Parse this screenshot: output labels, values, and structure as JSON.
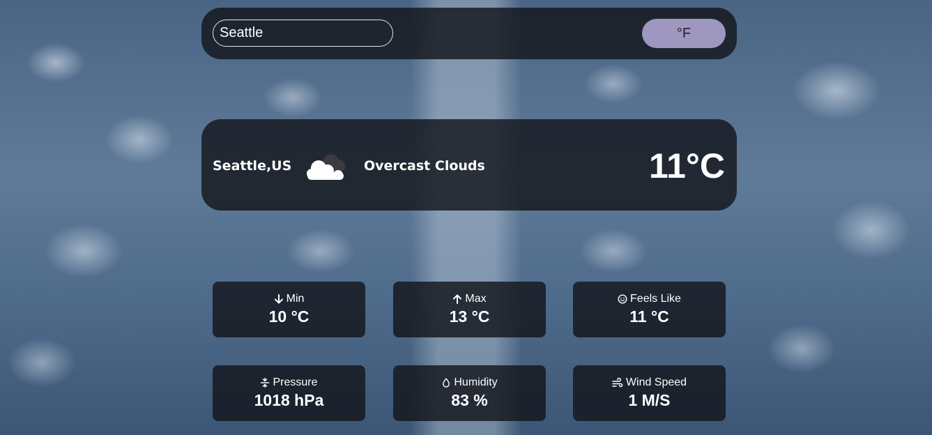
{
  "search": {
    "value": "Seattle",
    "unit_toggle_label": "°F"
  },
  "current": {
    "location": "Seattle,US",
    "condition_icon": "cloud-icon",
    "condition": "Overcast Clouds",
    "temperature": "11°C"
  },
  "stats": [
    {
      "icon": "arrow-down-icon",
      "label": "Min",
      "value": "10 °C"
    },
    {
      "icon": "arrow-up-icon",
      "label": "Max",
      "value": "13 °C"
    },
    {
      "icon": "smiley-icon",
      "label": "Feels Like",
      "value": "11 °C"
    },
    {
      "icon": "pressure-icon",
      "label": "Pressure",
      "value": "1018 hPa"
    },
    {
      "icon": "droplet-icon",
      "label": "Humidity",
      "value": "83 %"
    },
    {
      "icon": "wind-icon",
      "label": "Wind Speed",
      "value": "1 M/S"
    }
  ]
}
